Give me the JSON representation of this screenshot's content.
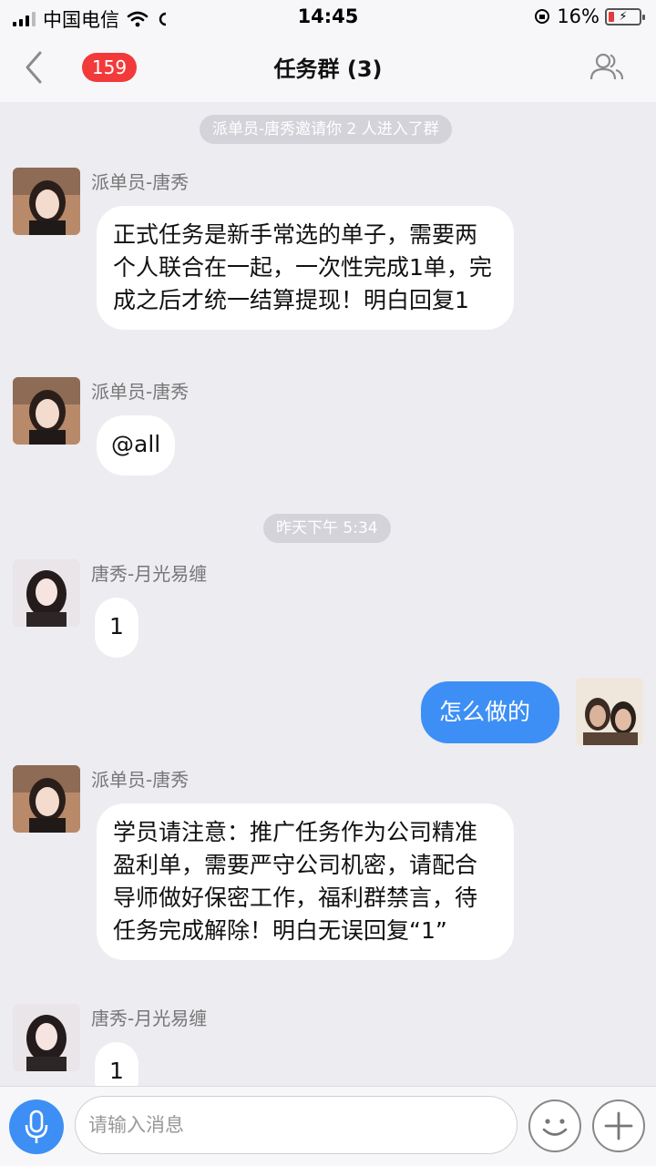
{
  "status": {
    "carrier": "中国电信",
    "time": "14:45",
    "battery": "16%"
  },
  "nav": {
    "unread_badge": "159",
    "title": "任务群 (3)"
  },
  "chat": {
    "system_notice": "派单员-唐秀邀请你 2 人进入了群",
    "timestamp": "昨天下午 5:34",
    "messages": [
      {
        "sender": "派单员-唐秀",
        "text": "正式任务是新手常选的单子，需要两个人联合在一起，一次性完成1单，完成之后才统一结算提现！明白回复1"
      },
      {
        "sender": "派单员-唐秀",
        "text": "@all"
      },
      {
        "sender": "唐秀-月光易缠",
        "text": "1"
      },
      {
        "sender": "me",
        "text": "怎么做的"
      },
      {
        "sender": "派单员-唐秀",
        "text": "学员请注意：推广任务作为公司精准盈利单，需要严守公司机密，请配合导师做好保密工作，福利群禁言，待任务完成解除！明白无误回复“1”"
      },
      {
        "sender": "唐秀-月光易缠",
        "text": "1"
      }
    ]
  },
  "input": {
    "placeholder": "请输入消息"
  },
  "colors": {
    "accent": "#3d8ff5",
    "badge": "#f23a3a",
    "chat_bg": "#ececf1"
  },
  "icons": [
    "back-chevron-icon",
    "group-members-icon",
    "microphone-icon",
    "emoji-icon",
    "plus-icon",
    "wifi-icon",
    "signal-icon",
    "battery-icon"
  ]
}
